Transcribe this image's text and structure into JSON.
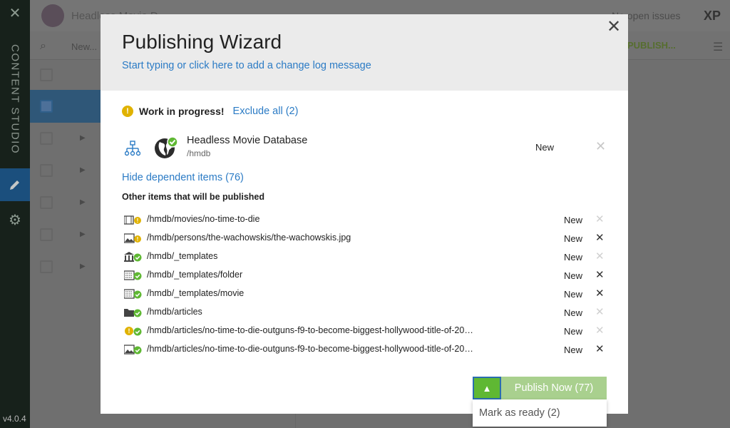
{
  "rail": {
    "app_label": "CONTENT STUDIO",
    "version": "v4.0.4"
  },
  "background": {
    "project": "Headless Movie D...",
    "issues": "No open issues",
    "brand": "XP",
    "new_label": "New...",
    "publish_label": "PUBLISH..."
  },
  "modal": {
    "title": "Publishing Wizard",
    "change_log_prompt": "Start typing or click here to add a change log message",
    "wip_label": "Work in progress!",
    "exclude_all": "Exclude all (2)",
    "main_item": {
      "name": "Headless Movie Database",
      "path": "/hmdb",
      "status": "New"
    },
    "hide_dependent": "Hide dependent items (76)",
    "other_heading": "Other items that will be published",
    "dependents": [
      {
        "path": "/hmdb/movies/no-time-to-die",
        "status": "New",
        "icon": "movie-icon",
        "state": "warning",
        "removable": false
      },
      {
        "path": "/hmdb/persons/the-wachowskis/the-wachowskis.jpg",
        "status": "New",
        "icon": "image-icon",
        "state": "warning",
        "removable": true
      },
      {
        "path": "/hmdb/_templates",
        "status": "New",
        "icon": "templates-icon",
        "state": "ready",
        "removable": false
      },
      {
        "path": "/hmdb/_templates/folder",
        "status": "New",
        "icon": "template-icon",
        "state": "ready",
        "removable": true
      },
      {
        "path": "/hmdb/_templates/movie",
        "status": "New",
        "icon": "template-icon",
        "state": "ready",
        "removable": true
      },
      {
        "path": "/hmdb/articles",
        "status": "New",
        "icon": "folder-icon",
        "state": "ready",
        "removable": false
      },
      {
        "path": "/hmdb/articles/no-time-to-die-outguns-f9-to-become-biggest-hollywood-title-of-20…",
        "status": "New",
        "icon": "article-icon",
        "state": "ready",
        "removable": false
      },
      {
        "path": "/hmdb/articles/no-time-to-die-outguns-f9-to-become-biggest-hollywood-title-of-20…",
        "status": "New",
        "icon": "image-icon",
        "state": "ready",
        "removable": true
      }
    ],
    "publish_button": "Publish Now (77)",
    "menu_item": "Mark as ready (2)"
  },
  "colors": {
    "accent": "#2b7bc5",
    "publish_green": "#a9d08e",
    "toggle_green": "#5fb833",
    "warning": "#e0b200",
    "ready": "#5fb833"
  }
}
